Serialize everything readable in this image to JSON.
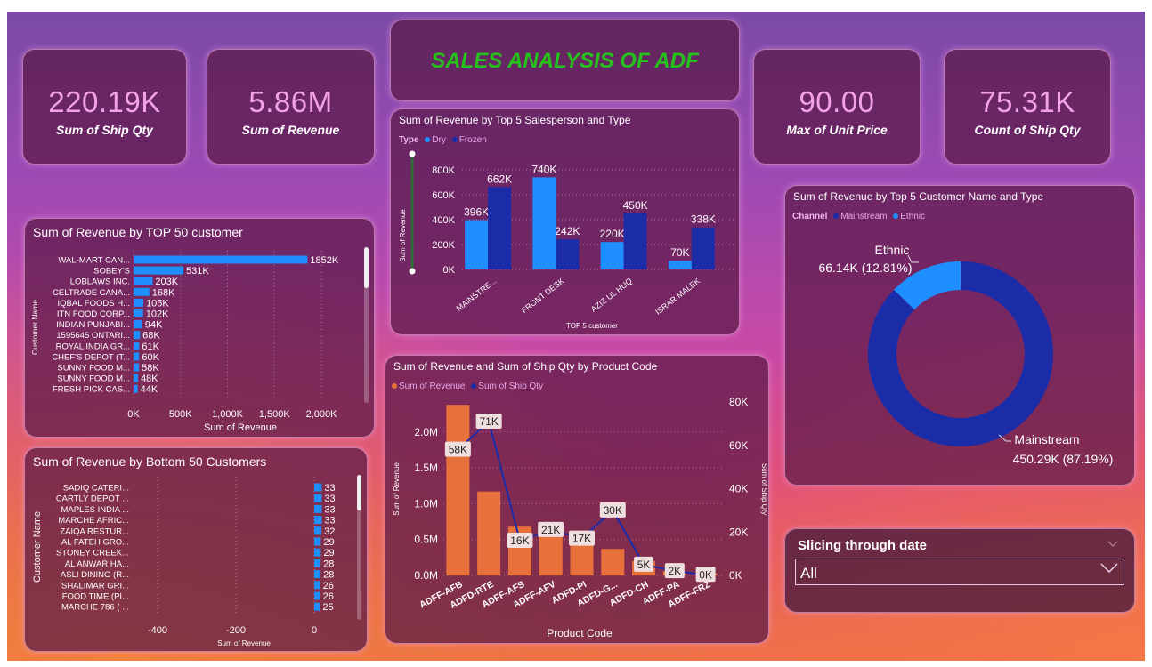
{
  "report": {
    "title": "SALES ANALYSIS OF ADF"
  },
  "kpis": [
    {
      "value": "220.19K",
      "label": "Sum of Ship Qty"
    },
    {
      "value": "5.86M",
      "label": "Sum of Revenue"
    },
    {
      "value": "90.00",
      "label": "Max of Unit Price"
    },
    {
      "value": "75.31K",
      "label": "Count of Ship Qty"
    }
  ],
  "colors": {
    "dry": "#1f8fff",
    "frozen": "#1b2ca8",
    "revenue_bar": "#e8703a",
    "ship_line": "#1b2ca8",
    "title_green": "#27c11d",
    "kpi_value": "#f3a2e8"
  },
  "slicer": {
    "title": "Slicing through date",
    "value": "All",
    "icon": "chevron-down-icon"
  },
  "chart_data": [
    {
      "id": "salesperson",
      "type": "bar",
      "title": "Sum of Revenue by Top 5 Salesperson and Type",
      "legend_title": "Type",
      "xlabel": "TOP 5 customer",
      "ylabel": "Sum of Revenue",
      "categories": [
        "MAINSTRE...",
        "FRONT DESK",
        "AZIZ UL HUQ",
        "ISRAR MALEK"
      ],
      "series": [
        {
          "name": "Dry",
          "values": [
            396000,
            740000,
            220000,
            70000
          ],
          "labels": [
            "396K",
            "740K",
            "220K",
            "70K"
          ]
        },
        {
          "name": "Frozen",
          "values": [
            662000,
            242000,
            450000,
            338000
          ],
          "labels": [
            "662K",
            "242K",
            "450K",
            "338K"
          ]
        }
      ],
      "ylim": [
        0,
        800000
      ],
      "yticks": [
        "0K",
        "200K",
        "400K",
        "600K",
        "800K"
      ],
      "legend": "top-left"
    },
    {
      "id": "top50",
      "type": "bar",
      "orientation": "horizontal",
      "title": "Sum of Revenue by TOP 50 customer",
      "xlabel": "Sum of Revenue",
      "ylabel": "Customer Name",
      "categories": [
        "WAL-MART CAN...",
        "SOBEY'S",
        "LOBLAWS INC.",
        "CELTRADE CANA...",
        "IQBAL FOODS H...",
        "ITN FOOD CORP...",
        "INDIAN PUNJABI...",
        "1595645 ONTARI...",
        "ROYAL INDIA GR...",
        "CHEF'S DEPOT (T...",
        "SUNNY FOOD M...",
        "SUNNY FOOD M...",
        "FRESH PICK CAS..."
      ],
      "values": [
        1852000,
        531000,
        203000,
        168000,
        105000,
        102000,
        94000,
        68000,
        61000,
        60000,
        58000,
        48000,
        44000
      ],
      "labels": [
        "1852K",
        "531K",
        "203K",
        "168K",
        "105K",
        "102K",
        "94K",
        "68K",
        "61K",
        "60K",
        "58K",
        "48K",
        "44K"
      ],
      "xlim": [
        0,
        2000000
      ],
      "xticks": [
        "0K",
        "500K",
        "1,000K",
        "1,500K",
        "2,000K"
      ]
    },
    {
      "id": "bottom50",
      "type": "bar",
      "orientation": "horizontal",
      "title": "Sum of Revenue by Bottom 50 Customers",
      "xlabel": "Sum of Revenue",
      "ylabel": "Customer Name",
      "categories": [
        "SADIQ CATERI...",
        "CARTLY DEPOT ...",
        "MAPLES INDIA ...",
        "MARCHE AFRIC...",
        "ZAIQA RESTUR...",
        "AL FATEH GRO...",
        "STONEY CREEK...",
        "AL ANWAR HA...",
        "ASLI DINING (R...",
        "SHALIMAR GRI...",
        "FOOD TIME (PI...",
        "MARCHE 786 ( ..."
      ],
      "values": [
        33,
        33,
        33,
        33,
        32,
        29,
        29,
        28,
        28,
        26,
        26,
        25
      ],
      "xlim": [
        -400,
        0
      ],
      "xticks": [
        "-400",
        "-200",
        "0"
      ]
    },
    {
      "id": "product",
      "type": "bar",
      "title": "Sum of Revenue and Sum of Ship Qty by Product Code",
      "xlabel": "Product Code",
      "ylabel": "Sum of Revenue",
      "y2label": "Sum of Ship Qty",
      "categories": [
        "ADFF-AFB",
        "ADFD-RTE",
        "ADFF-AFS",
        "ADFF-AFV",
        "ADFD-PI",
        "ADFD-G...",
        "ADFD-CH",
        "ADFF-PA",
        "ADFF-FRZ"
      ],
      "series": [
        {
          "name": "Sum of Revenue",
          "type": "bar",
          "values": [
            2380000,
            1170000,
            680000,
            610000,
            420000,
            370000,
            200000,
            60000,
            30000
          ]
        },
        {
          "name": "Sum of Ship Qty",
          "type": "line",
          "values": [
            58000,
            71000,
            16000,
            21000,
            17000,
            30000,
            5000,
            2000,
            300
          ],
          "labels": [
            "58K",
            "71K",
            "16K",
            "21K",
            "17K",
            "30K",
            "5K",
            "2K",
            "0K"
          ]
        }
      ],
      "ylim": [
        0,
        2400000
      ],
      "yticks": [
        "0.0M",
        "0.5M",
        "1.0M",
        "1.5M",
        "2.0M"
      ],
      "y2lim": [
        0,
        80000
      ],
      "y2ticks": [
        "0K",
        "20K",
        "40K",
        "60K",
        "80K"
      ]
    },
    {
      "id": "customer_type",
      "type": "pie",
      "title": "Sum of Revenue by Top 5 Customer Name and Type",
      "legend_title": "Channel",
      "slices": [
        {
          "name": "Mainstream",
          "value": 450290,
          "label": "450.29K (87.19%)",
          "color": "#1b2ca8"
        },
        {
          "name": "Ethnic",
          "value": 66140,
          "label": "66.14K (12.81%)",
          "color": "#1f8fff"
        }
      ],
      "legend": "top-left"
    }
  ]
}
